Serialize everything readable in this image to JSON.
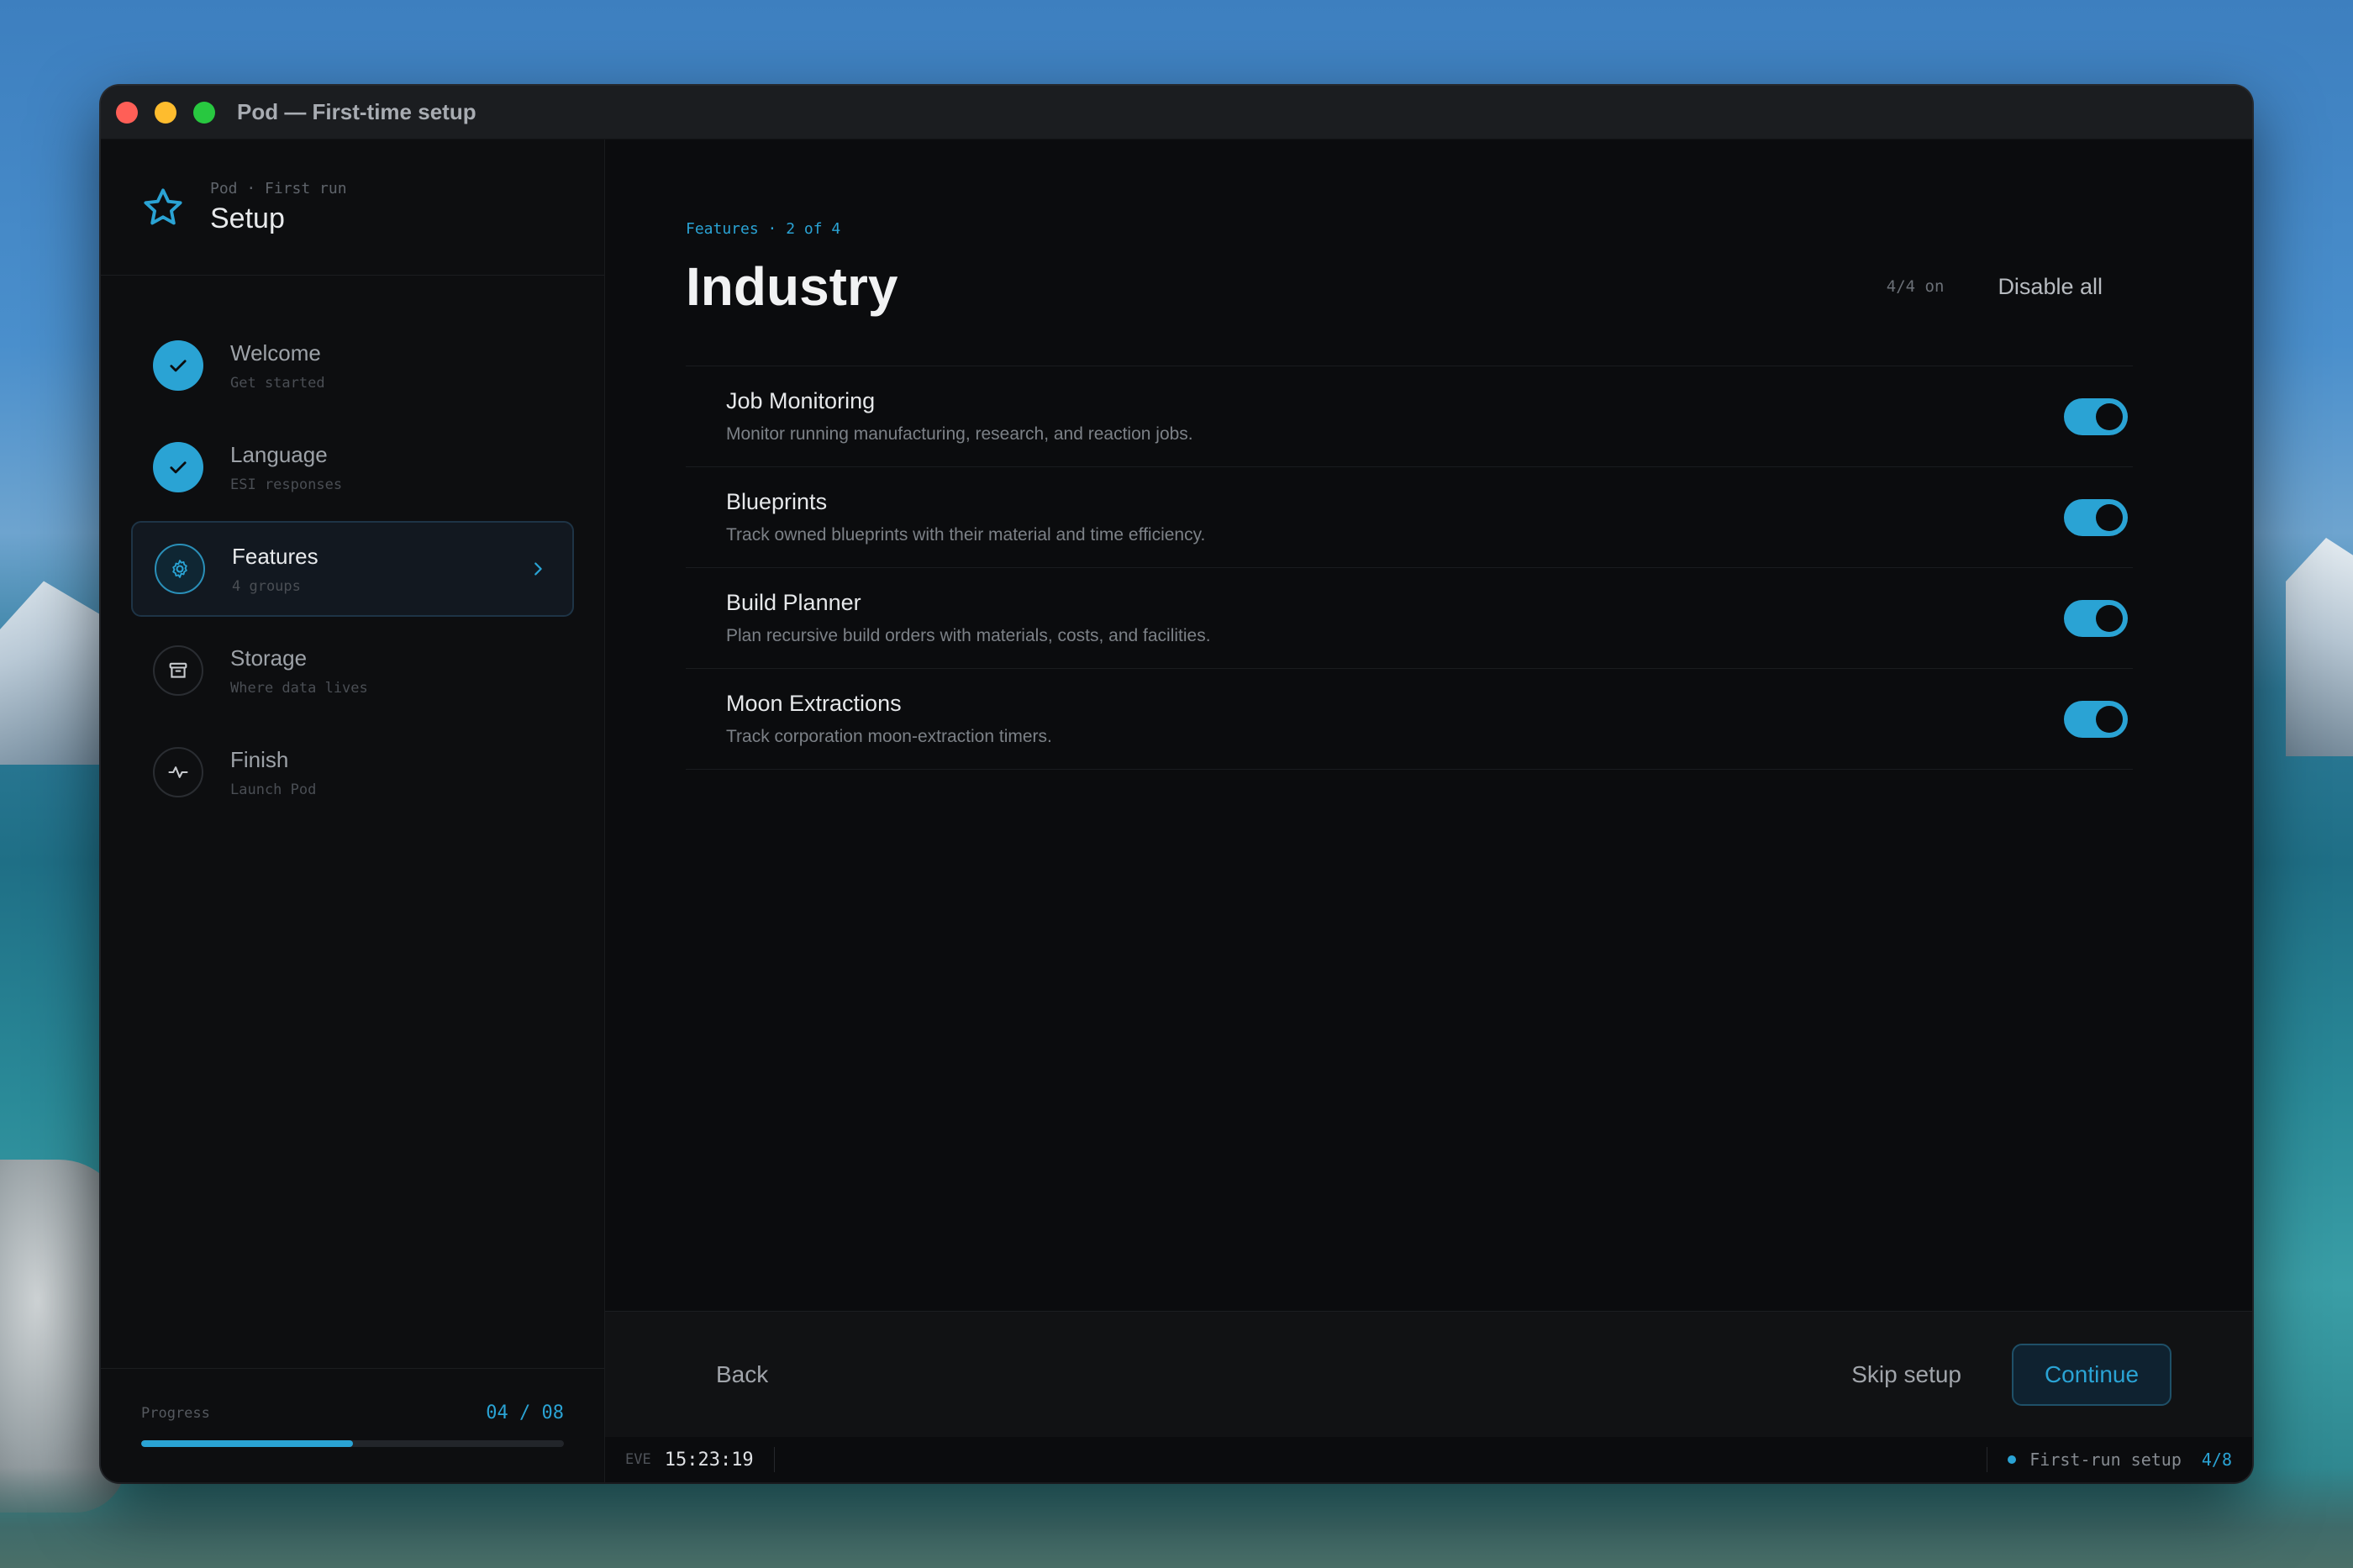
{
  "window": {
    "title": "Pod — First-time setup"
  },
  "brand": {
    "sub": "Pod · First run",
    "title": "Setup"
  },
  "steps": [
    {
      "label": "Welcome",
      "sub": "Get started",
      "state": "done"
    },
    {
      "label": "Language",
      "sub": "ESI responses",
      "state": "done"
    },
    {
      "label": "Features",
      "sub": "4 groups",
      "state": "current"
    },
    {
      "label": "Storage",
      "sub": "Where data lives",
      "state": "pending"
    },
    {
      "label": "Finish",
      "sub": "Launch Pod",
      "state": "pending"
    }
  ],
  "progress": {
    "label": "Progress",
    "count": "04 / 08",
    "fraction": 0.5
  },
  "main": {
    "crumb": "Features · 2 of 4",
    "title": "Industry",
    "count_on": "4/4 on",
    "disable_all": "Disable all"
  },
  "features": [
    {
      "name": "Job Monitoring",
      "desc": "Monitor running manufacturing, research, and reaction jobs.",
      "enabled": true
    },
    {
      "name": "Blueprints",
      "desc": "Track owned blueprints with their material and time efficiency.",
      "enabled": true
    },
    {
      "name": "Build Planner",
      "desc": "Plan recursive build orders with materials, costs, and facilities.",
      "enabled": true
    },
    {
      "name": "Moon Extractions",
      "desc": "Track corporation moon-extraction timers.",
      "enabled": true
    }
  ],
  "footer": {
    "back": "Back",
    "skip": "Skip setup",
    "continue": "Continue"
  },
  "statusbar": {
    "eve_label": "EVE",
    "time": "15:23:19",
    "text": "First-run setup",
    "count": "4/8"
  },
  "colors": {
    "accent": "#2aa3d4",
    "background": "#0b0c0e",
    "sidebar": "#0d0e10"
  }
}
